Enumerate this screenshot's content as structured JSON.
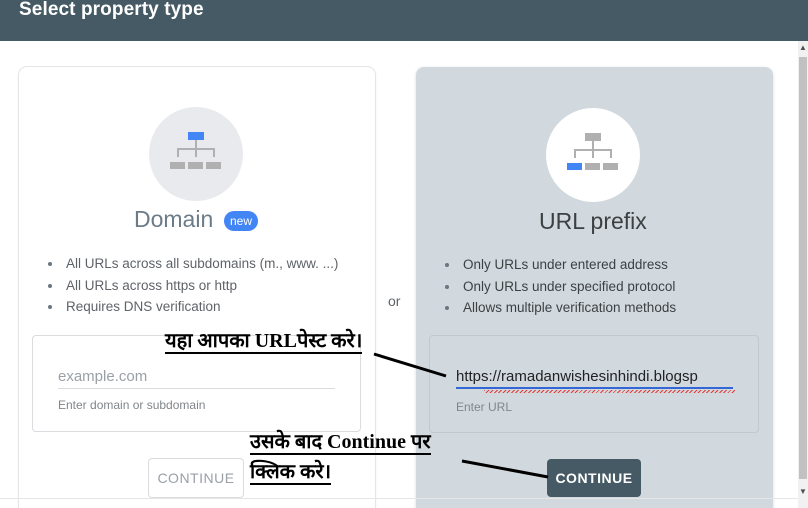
{
  "header": {
    "title": "Select property type"
  },
  "domain_card": {
    "title": "Domain",
    "badge": "new",
    "features": [
      "All URLs across all subdomains (m., www. ...)",
      "All URLs across https or http",
      "Requires DNS verification"
    ],
    "input": {
      "value": "",
      "placeholder": "example.com",
      "hint": "Enter domain or subdomain"
    },
    "button_label": "CONTINUE"
  },
  "separator": "or",
  "url_card": {
    "title": "URL prefix",
    "features": [
      "Only URLs under entered address",
      "Only URLs under specified protocol",
      "Allows multiple verification methods"
    ],
    "input": {
      "value": "https://ramadanwishesinhindi.blogsp",
      "placeholder": "",
      "hint": "Enter URL"
    },
    "button_label": "CONTINUE"
  },
  "annotations": {
    "paste_url": "यहा आपका URLपेस्ट करे।",
    "continue_line1": "उसके बाद Continue पर",
    "continue_line2": "क्लिक करे।"
  },
  "icons": {
    "domain": "sitemap-top-highlight-icon",
    "url_prefix": "sitemap-branch-highlight-icon"
  },
  "colors": {
    "header_bg": "#455a64",
    "accent_blue": "#4285f4",
    "url_card_bg": "#d2d9de",
    "primary_button": "#455a64"
  }
}
